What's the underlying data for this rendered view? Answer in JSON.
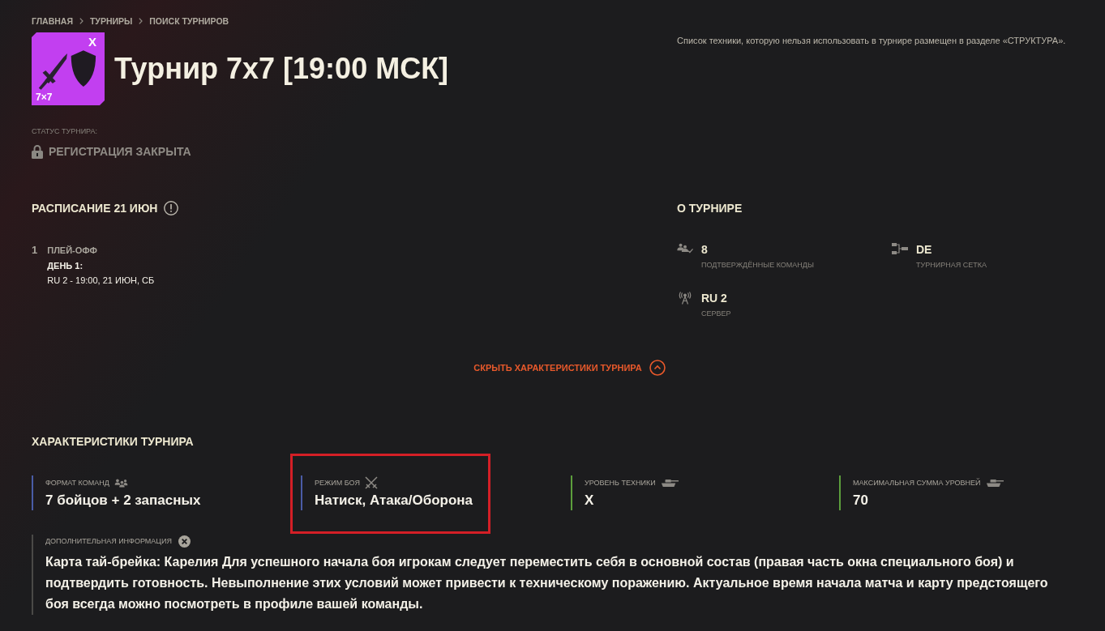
{
  "breadcrumbs": [
    {
      "label": "ГЛАВНАЯ"
    },
    {
      "label": "ТУРНИРЫ"
    },
    {
      "label": "ПОИСК ТУРНИРОВ"
    }
  ],
  "tournament_badge": {
    "tier": "X",
    "format": "7×7"
  },
  "title": "Турнир 7x7 [19:00 МСК]",
  "notice": "Список техники, которую нельзя использовать в турнире размещен в разделе «СТРУКТУРА».",
  "status": {
    "label": "СТАТУС ТУРНИРА:",
    "value": "РЕГИСТРАЦИЯ ЗАКРЫТА"
  },
  "schedule": {
    "heading": "РАСПИСАНИЕ 21 ИЮН",
    "stages": [
      {
        "number": "1",
        "name": "ПЛЕЙ-ОФФ",
        "days": [
          {
            "label": "ДЕНЬ 1:",
            "time": "RU 2 - 19:00, 21 ИЮН, СБ"
          }
        ]
      }
    ]
  },
  "about": {
    "heading": "О ТУРНИРЕ",
    "items": [
      {
        "kind": "teams",
        "value": "8",
        "label": "ПОДТВЕРЖДЁННЫЕ КОМАНДЫ"
      },
      {
        "kind": "bracket",
        "value": "DE",
        "label": "ТУРНИРНАЯ СЕТКА"
      },
      {
        "kind": "server",
        "value": "RU 2",
        "label": "СЕРВЕР"
      }
    ]
  },
  "toggle": {
    "label": "СКРЫТЬ ХАРАКТЕРИСТИКИ ТУРНИРА",
    "expanded": true
  },
  "characteristics": {
    "heading": "ХАРАКТЕРИСТИКИ ТУРНИРА",
    "items": [
      {
        "kind": "team_format",
        "label": "ФОРМАТ КОМАНД",
        "value": "7 бойцов + 2 запасных",
        "color": "#4a5ca6",
        "highlighted": false
      },
      {
        "kind": "battle_mode",
        "label": "РЕЖИМ БОЯ",
        "value": "Натиск, Атака/Оборона",
        "color": "#4a5ca6",
        "highlighted": true
      },
      {
        "kind": "vehicle_tier",
        "label": "УРОВЕНЬ ТЕХНИКИ",
        "value": "X",
        "color": "#5c9e3c",
        "highlighted": false
      },
      {
        "kind": "tier_sum",
        "label": "МАКСИМАЛЬНАЯ СУММА УРОВНЕЙ",
        "value": "70",
        "color": "#5c9e3c",
        "highlighted": false
      }
    ]
  },
  "additional_info": {
    "label": "ДОПОЛНИТЕЛЬНАЯ ИНФОРМАЦИЯ",
    "text": "Карта тай-брейка: Карелия Для успешного начала боя игрокам следует переместить себя в основной состав (правая часть окна специального боя) и подтвердить готовность. Невыполнение этих условий может привести к техническому поражению. Актуальное время начала матча и карту предстоящего боя всегда можно посмотреть в профиле вашей команды."
  }
}
